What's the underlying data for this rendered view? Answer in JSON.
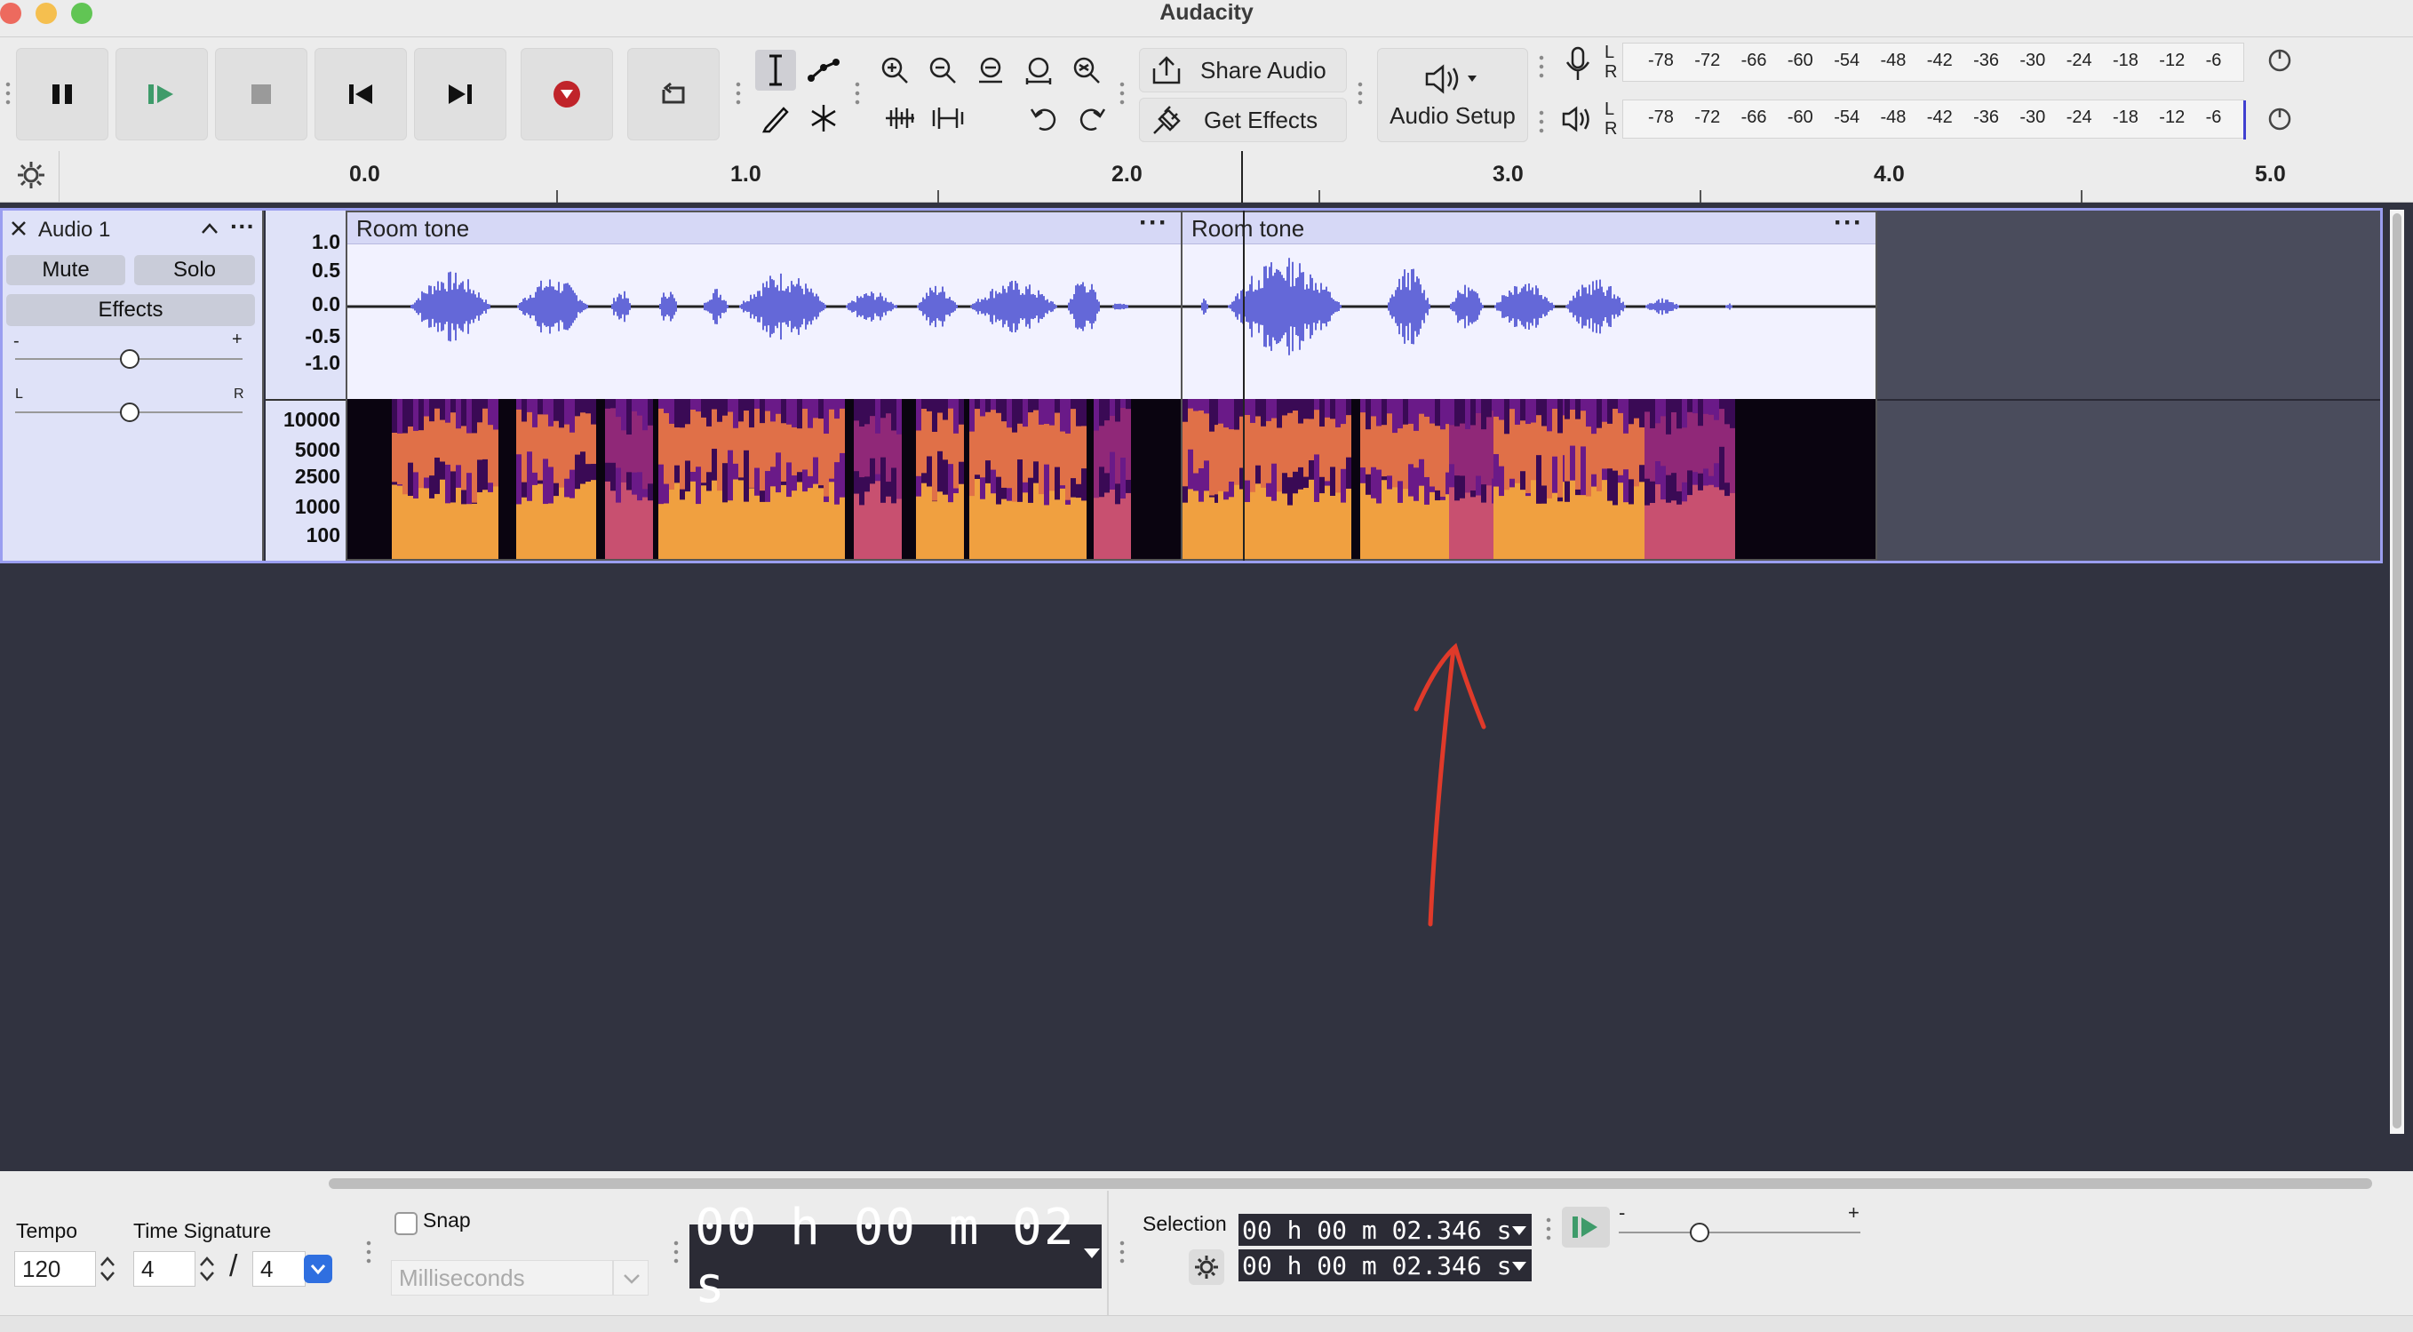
{
  "window": {
    "title": "Audacity"
  },
  "toolbar": {
    "share_audio": "Share Audio",
    "get_effects": "Get Effects",
    "audio_setup": "Audio Setup"
  },
  "meters": {
    "scale": [
      "-78",
      "-72",
      "-66",
      "-60",
      "-54",
      "-48",
      "-42",
      "-36",
      "-30",
      "-24",
      "-18",
      "-12",
      "-6"
    ],
    "channel_l": "L",
    "channel_r": "R"
  },
  "ruler": {
    "labels": [
      "0.0",
      "1.0",
      "2.0",
      "3.0",
      "4.0",
      "5.0"
    ]
  },
  "track": {
    "name": "Audio 1",
    "mute": "Mute",
    "solo": "Solo",
    "effects": "Effects",
    "gain_minus": "-",
    "gain_plus": "+",
    "pan_l": "L",
    "pan_r": "R",
    "wave_scale": [
      "1.0",
      "0.5",
      "0.0",
      "-0.5",
      "-1.0"
    ],
    "spec_scale": [
      "10000",
      "5000",
      "2500",
      "1000",
      "100"
    ],
    "clips": [
      {
        "name": "Room tone"
      },
      {
        "name": "Room tone"
      }
    ]
  },
  "bottom": {
    "tempo_label": "Tempo",
    "tempo_value": "120",
    "time_sig_label": "Time Signature",
    "time_sig_num": "4",
    "time_sig_sep": "/",
    "time_sig_den": "4",
    "snap_label": "Snap",
    "snap_unit": "Milliseconds",
    "time_display": "00 h 00 m 02 s",
    "selection_label": "Selection",
    "selection_start": "00 h 00 m 02.346 s",
    "selection_end": "00 h 00 m 02.346 s",
    "speed_minus": "-",
    "speed_plus": "+"
  },
  "colors": {
    "waveform": "#6468d8",
    "annotation": "#e03a2a",
    "selection_border": "#9a9ef0"
  }
}
